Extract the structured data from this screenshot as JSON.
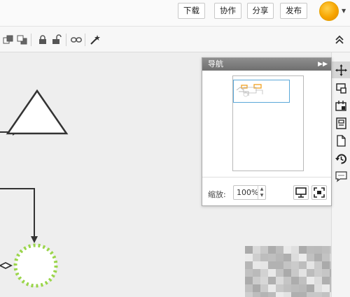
{
  "header": {
    "buttons": [
      {
        "label": "下载"
      },
      {
        "label": "协作"
      },
      {
        "label": "分享"
      },
      {
        "label": "发布"
      }
    ],
    "avatar_color": "#f7a500"
  },
  "toolbar": {
    "icons": [
      "bring-front-icon",
      "send-back-icon",
      "lock-icon",
      "unlock-icon",
      "link-icon",
      "magic-wand-icon"
    ],
    "collapse_icon": "chevron-double-up-icon"
  },
  "navigator": {
    "title": "导航",
    "zoom_label": "缩放:",
    "zoom_value": "100%"
  },
  "right_sidebar": {
    "icons": [
      "navigator-icon",
      "format-icon",
      "page-settings-icon",
      "clipboard-icon",
      "page-icon",
      "history-icon",
      "comment-icon"
    ]
  },
  "colors": {
    "accent_selection": "#5aa8d8",
    "dashed_green": "#9ad54a",
    "shape_stroke": "#333333"
  }
}
